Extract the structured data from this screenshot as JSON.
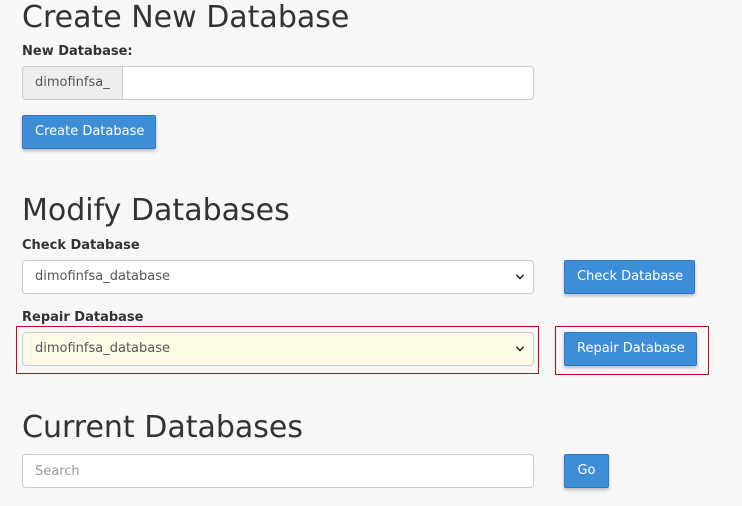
{
  "create_section": {
    "heading": "Create New Database",
    "label": "New Database:",
    "prefix": "dimofinfsa_",
    "input_value": "",
    "button_label": "Create Database"
  },
  "modify_section": {
    "heading": "Modify Databases",
    "check": {
      "label": "Check Database",
      "selected": "dimofinfsa_database",
      "button_label": "Check Database"
    },
    "repair": {
      "label": "Repair Database",
      "selected": "dimofinfsa_database",
      "button_label": "Repair Database"
    }
  },
  "current_section": {
    "heading": "Current Databases",
    "search_placeholder": "Search",
    "go_label": "Go"
  },
  "colors": {
    "button": "#3e8ed7",
    "highlight_border": "#d0021b",
    "highlight_select": "#fdfbe8"
  },
  "icons": {
    "select_arrow": "chevron-down-icon"
  }
}
